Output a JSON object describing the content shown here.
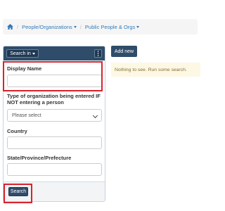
{
  "breadcrumb": {
    "home_icon": "home-icon",
    "items": [
      {
        "label": "People/Organizations"
      },
      {
        "label": "Public People & Orgs"
      }
    ]
  },
  "search_panel": {
    "search_in_label": "Search in",
    "menu_icon": "vertical-ellipsis-icon",
    "fields": {
      "display_name": {
        "label": "Display Name",
        "value": ""
      },
      "org_type": {
        "label": "Type of organization being entered IF NOT entering a person",
        "selected": "Please select"
      },
      "country": {
        "label": "Country",
        "value": ""
      },
      "state": {
        "label": "State/Province/Prefecture",
        "value": ""
      }
    },
    "search_button_label": "Search"
  },
  "actions": {
    "add_new_label": "Add new"
  },
  "results": {
    "empty_message": "Nothing to see. Run some search."
  },
  "colors": {
    "primary": "#2f4c6a",
    "link": "#337ab7",
    "highlight": "#d9232d",
    "warning_bg": "#fcf8e3",
    "warning_text": "#8a6d3b"
  }
}
